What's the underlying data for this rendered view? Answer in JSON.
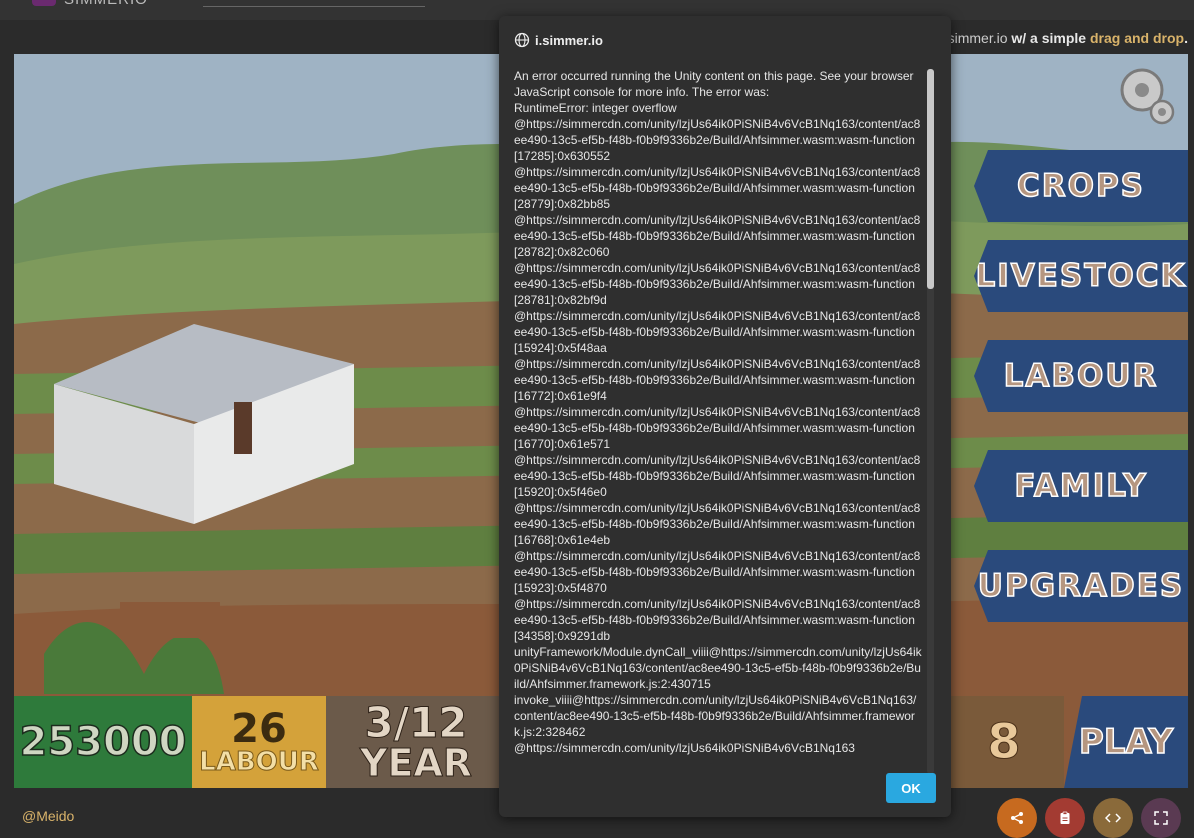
{
  "topbar": {
    "logo_text": "SIMMERIO"
  },
  "tagline": {
    "domain": "simmer.io",
    "middle": " w/ a simple ",
    "highlight": "drag and drop",
    "end": "."
  },
  "game": {
    "menu": [
      "CROPS",
      "LIVESTOCK",
      "LABOUR",
      "FAMILY",
      "UPGRADES"
    ],
    "stats": {
      "money": "253000",
      "labour_count": "26",
      "labour_label": "LABOUR",
      "date": "3/12",
      "year_label": "YEAR",
      "goats": "8"
    },
    "play_label": "PLAY"
  },
  "dialog": {
    "title": "i.simmer.io",
    "message": "An error occurred running the Unity content on this page. See your browser JavaScript console for more info. The error was:\nRuntimeError: integer overflow\n@https://simmercdn.com/unity/lzjUs64ik0PiSNiB4v6VcB1Nq163/content/ac8ee490-13c5-ef5b-f48b-f0b9f9336b2e/Build/Ahfsimmer.wasm:wasm-function[17285]:0x630552\n@https://simmercdn.com/unity/lzjUs64ik0PiSNiB4v6VcB1Nq163/content/ac8ee490-13c5-ef5b-f48b-f0b9f9336b2e/Build/Ahfsimmer.wasm:wasm-function[28779]:0x82bb85\n@https://simmercdn.com/unity/lzjUs64ik0PiSNiB4v6VcB1Nq163/content/ac8ee490-13c5-ef5b-f48b-f0b9f9336b2e/Build/Ahfsimmer.wasm:wasm-function[28782]:0x82c060\n@https://simmercdn.com/unity/lzjUs64ik0PiSNiB4v6VcB1Nq163/content/ac8ee490-13c5-ef5b-f48b-f0b9f9336b2e/Build/Ahfsimmer.wasm:wasm-function[28781]:0x82bf9d\n@https://simmercdn.com/unity/lzjUs64ik0PiSNiB4v6VcB1Nq163/content/ac8ee490-13c5-ef5b-f48b-f0b9f9336b2e/Build/Ahfsimmer.wasm:wasm-function[15924]:0x5f48aa\n@https://simmercdn.com/unity/lzjUs64ik0PiSNiB4v6VcB1Nq163/content/ac8ee490-13c5-ef5b-f48b-f0b9f9336b2e/Build/Ahfsimmer.wasm:wasm-function[16772]:0x61e9f4\n@https://simmercdn.com/unity/lzjUs64ik0PiSNiB4v6VcB1Nq163/content/ac8ee490-13c5-ef5b-f48b-f0b9f9336b2e/Build/Ahfsimmer.wasm:wasm-function[16770]:0x61e571\n@https://simmercdn.com/unity/lzjUs64ik0PiSNiB4v6VcB1Nq163/content/ac8ee490-13c5-ef5b-f48b-f0b9f9336b2e/Build/Ahfsimmer.wasm:wasm-function[15920]:0x5f46e0\n@https://simmercdn.com/unity/lzjUs64ik0PiSNiB4v6VcB1Nq163/content/ac8ee490-13c5-ef5b-f48b-f0b9f9336b2e/Build/Ahfsimmer.wasm:wasm-function[16768]:0x61e4eb\n@https://simmercdn.com/unity/lzjUs64ik0PiSNiB4v6VcB1Nq163/content/ac8ee490-13c5-ef5b-f48b-f0b9f9336b2e/Build/Ahfsimmer.wasm:wasm-function[15923]:0x5f4870\n@https://simmercdn.com/unity/lzjUs64ik0PiSNiB4v6VcB1Nq163/content/ac8ee490-13c5-ef5b-f48b-f0b9f9336b2e/Build/Ahfsimmer.wasm:wasm-function[34358]:0x9291db\nunityFramework/Module.dynCall_viiii@https://simmercdn.com/unity/lzjUs64ik0PiSNiB4v6VcB1Nq163/content/ac8ee490-13c5-ef5b-f48b-f0b9f9336b2e/Build/Ahfsimmer.framework.js:2:430715\ninvoke_viiii@https://simmercdn.com/unity/lzjUs64ik0PiSNiB4v6VcB1Nq163/content/ac8ee490-13c5-ef5b-f48b-f0b9f9336b2e/Build/Ahfsimmer.framework.js:2:328462\n@https://simmercdn.com/unity/lzjUs64ik0PiSNiB4v6VcB1Nq163",
    "ok_label": "OK"
  },
  "footer": {
    "author": "@Meido"
  },
  "icons": {
    "title": "globe-icon",
    "share": "share-icon",
    "clipboard": "clipboard-icon",
    "code": "code-icon",
    "fullscreen": "fullscreen-icon",
    "settings": "gear-icon"
  },
  "colors": {
    "accent": "#2aa8e0",
    "menu_bg": "#2a4a7c",
    "money_bg": "#2e7a3b",
    "labour_bg": "#d4a23a",
    "author": "#d9b36a"
  }
}
